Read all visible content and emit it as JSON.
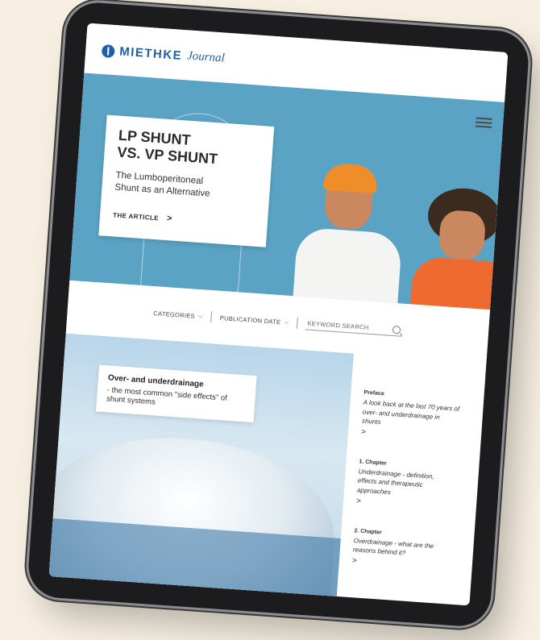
{
  "header": {
    "brand": "MIETHKE",
    "journal": "Journal"
  },
  "hero": {
    "title_line1": "LP SHUNT",
    "title_line2": "VS. VP SHUNT",
    "subtitle_line1": "The Lumboperitoneal",
    "subtitle_line2": "Shunt as an Alternative",
    "link": "THE ARTICLE",
    "link_chevron": ">"
  },
  "filters": {
    "categories": "CATEGORIES",
    "publication_date": "PUBLICATION DATE",
    "search_placeholder": "KEYWORD SEARCH",
    "chevron": "⌵"
  },
  "feature": {
    "title": "Over- and underdrainage",
    "subtitle": "- the most common \"side effects\" of shunt systems"
  },
  "chapters": [
    {
      "title": "Preface",
      "desc": "A look back at the last 70 years of over- and underdrainage in shunts",
      "chev": ">"
    },
    {
      "title": "1. Chapter",
      "desc": "Underdrainage - definition, effects and therapeutic approaches",
      "chev": ">"
    },
    {
      "title": "2. Chapter",
      "desc": "Overdrainage - what are the reasons behind it?",
      "chev": ">"
    }
  ],
  "colors": {
    "brand_blue": "#1f5fa6",
    "hero_bg": "#5aa3c4",
    "orange": "#f08d2b"
  }
}
